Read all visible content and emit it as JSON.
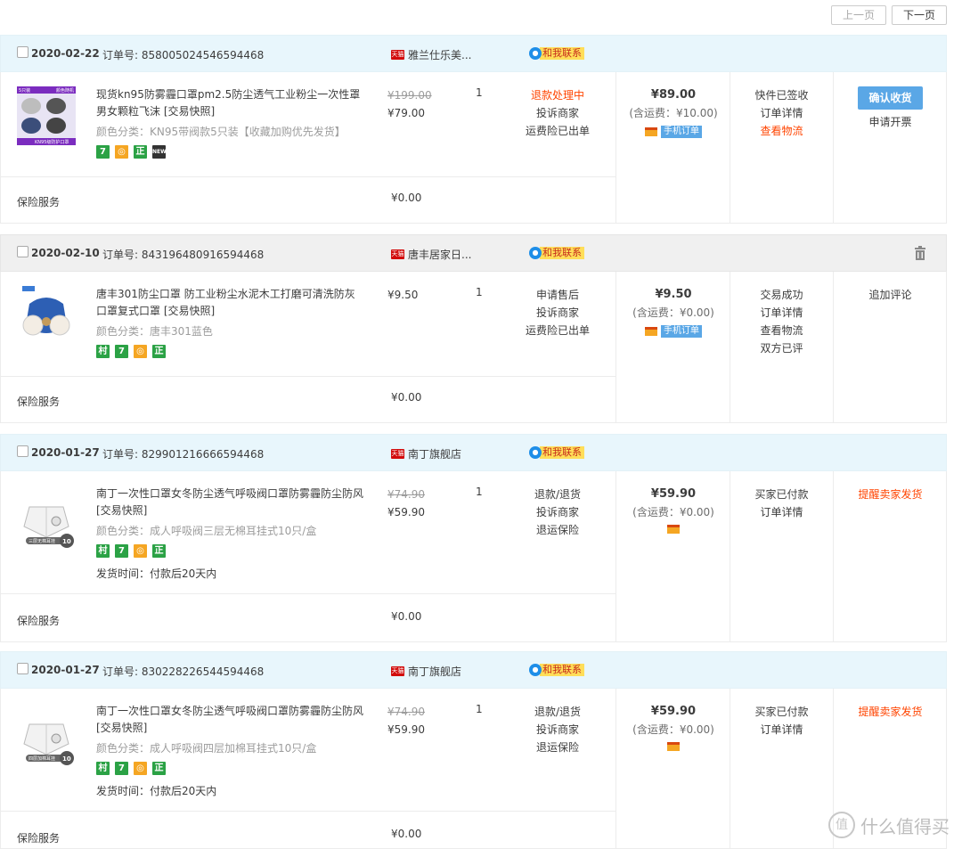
{
  "pager": {
    "prev": "上一页",
    "next": "下一页"
  },
  "labels": {
    "order_no_prefix": "订单号: ",
    "contact": "和我联系",
    "insurance": "保险服务",
    "insurance_price": "¥0.00",
    "mobile_order": "手机订单"
  },
  "orders": [
    {
      "date": "2020-02-22",
      "order_no": "订单号: 858005024546594468",
      "shop": "雅兰仕乐美...",
      "title": "现货kn95防雾霾口罩pm2.5防尘透气工业粉尘一次性罩男女颗粒飞沫 [交易快照]",
      "sku": "颜色分类：KN95带阀款5只装【收藏加购优先发货】",
      "orig_price": "¥199.00",
      "price": "¥79.00",
      "qty": "1",
      "status": [
        "退款处理中",
        "投诉商家",
        "运费险已出单"
      ],
      "total": "¥89.00",
      "fee": "(含运费：¥10.00)",
      "trade": [
        "快件已签收",
        "订单详情",
        "查看物流"
      ],
      "op_button": "确认收货",
      "op": [
        "申请开票"
      ]
    },
    {
      "date": "2020-02-10",
      "order_no": "订单号: 843196480916594468",
      "shop": "唐丰居家日...",
      "title": "唐丰301防尘口罩 防工业粉尘水泥木工打磨可清洗防灰口罩复式口罩 [交易快照]",
      "sku": "颜色分类：唐丰301蓝色",
      "price": "¥9.50",
      "qty": "1",
      "status": [
        "申请售后",
        "投诉商家",
        "运费险已出单"
      ],
      "total": "¥9.50",
      "fee": "(含运费：¥0.00)",
      "trade": [
        "交易成功",
        "订单详情",
        "查看物流",
        "双方已评"
      ],
      "op": [
        "追加评论"
      ]
    },
    {
      "date": "2020-01-27",
      "order_no": "订单号: 829901216666594468",
      "shop": "南丁旗舰店",
      "title": "南丁一次性口罩女冬防尘透气呼吸阀口罩防雾霾防尘防风 [交易快照]",
      "sku": "颜色分类：成人呼吸阀三层无棉耳挂式10只/盒",
      "ship": "发货时间：付款后20天内",
      "orig_price": "¥74.90",
      "price": "¥59.90",
      "qty": "1",
      "status": [
        "退款/退货",
        "投诉商家",
        "退运保险"
      ],
      "total": "¥59.90",
      "fee": "(含运费：¥0.00)",
      "trade": [
        "买家已付款",
        "订单详情"
      ],
      "op": [
        "提醒卖家发货"
      ],
      "thumb_label": "三层无棉耳挂"
    },
    {
      "date": "2020-01-27",
      "order_no": "订单号: 830228226544594468",
      "shop": "南丁旗舰店",
      "title": "南丁一次性口罩女冬防尘透气呼吸阀口罩防雾霾防尘防风 [交易快照]",
      "sku": "颜色分类：成人呼吸阀四层加棉耳挂式10只/盒",
      "ship": "发货时间：付款后20天内",
      "orig_price": "¥74.90",
      "price": "¥59.90",
      "qty": "1",
      "status": [
        "退款/退货",
        "投诉商家",
        "退运保险"
      ],
      "total": "¥59.90",
      "fee": "(含运费：¥0.00)",
      "trade": [
        "买家已付款",
        "订单详情"
      ],
      "op": [
        "提醒卖家发货"
      ],
      "thumb_label": "四层加棉耳挂"
    }
  ],
  "badge_text": {
    "b1": "7",
    "b2": "正",
    "b3": "村",
    "badge_new": "NEW"
  },
  "thumb1": {
    "l1": "5只装",
    "l2": "颜色随机",
    "l3": "KN95级防护口罩"
  },
  "thumb_count": "10",
  "watermark": {
    "logo": "值",
    "text": "什么值得买"
  },
  "colors": {
    "accent_blue": "#5aa7e6",
    "alert_red": "#ff4400",
    "head_blue": "#e8f6fc"
  }
}
